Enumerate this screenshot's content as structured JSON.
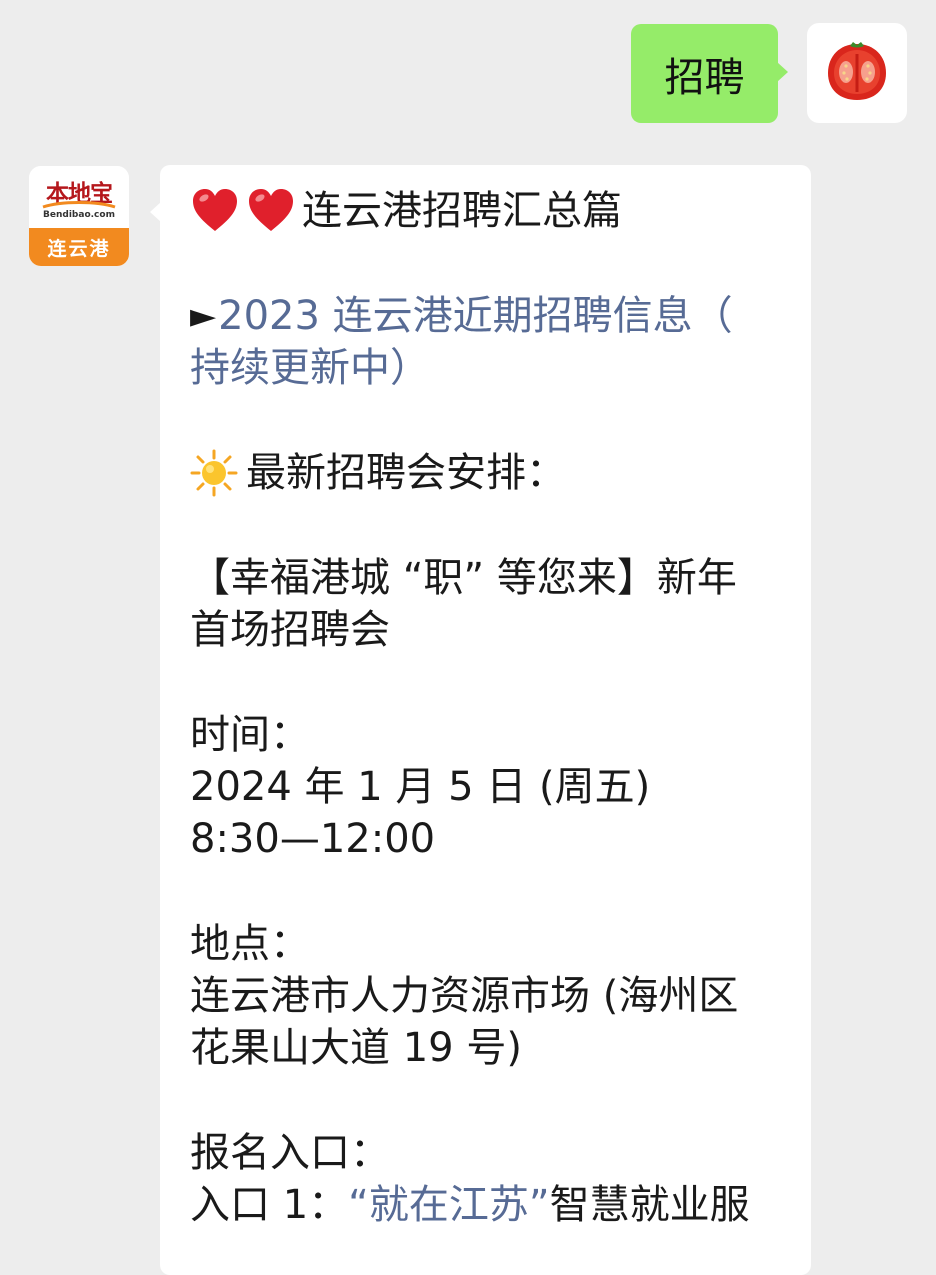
{
  "outgoing": {
    "text": "招聘",
    "avatar_icon": "tomato-icon"
  },
  "incoming": {
    "avatar": {
      "brand": "本地宝",
      "domain": "Bendibao.com",
      "city": "连云港"
    },
    "title": "连云港招聘汇总篇",
    "title_icons": [
      "heart-icon",
      "heart-icon"
    ],
    "link_arrow": "►",
    "link_line1": "2023 连云港近期招聘信息（",
    "link_line2": "持续更新中）",
    "section_icon": "sun-icon",
    "section_heading": "最新招聘会安排：",
    "fair_name_line1": "【幸福港城 “职” 等您来】新年",
    "fair_name_line2": "首场招聘会",
    "time_label": "时间：",
    "time_date": "2024 年 1 月 5 日 (周五)",
    "time_range": "8:30—12:00",
    "place_label": "地点：",
    "place_line1": "连云港市人力资源市场 (海州区",
    "place_line2": "花果山大道 19 号)",
    "signup_label": "报名入口：",
    "entry1_prefix": "入口 1：",
    "entry1_link": "“就在江苏”",
    "entry1_suffix": " 智慧就业服"
  },
  "colors": {
    "background": "#ededed",
    "outgoing_bubble": "#95ec69",
    "incoming_bubble": "#ffffff",
    "link": "#576b95",
    "brand_red": "#b5171c",
    "brand_orange": "#f28a1f"
  }
}
